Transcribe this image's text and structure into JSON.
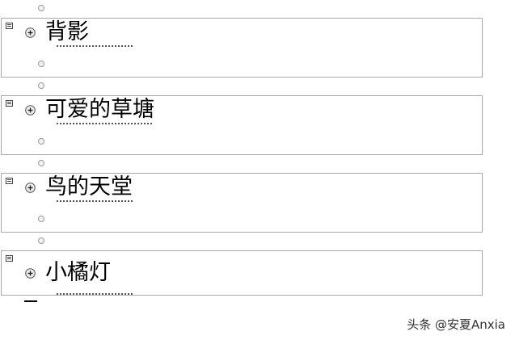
{
  "outline": {
    "sections": [
      {
        "heading": "背影"
      },
      {
        "heading": "可爱的草塘"
      },
      {
        "heading": "鸟的天堂"
      },
      {
        "heading": "小橘灯"
      }
    ]
  },
  "icons": {
    "bullet": "empty-bullet-icon",
    "anchor": "section-anchor-icon",
    "expand": "expand-plus-icon"
  },
  "watermark": {
    "text": "头条 @安夏Anxia"
  },
  "colors": {
    "border": "#a8a8a8",
    "bullet": "#9a9a9a",
    "text": "#000000"
  }
}
